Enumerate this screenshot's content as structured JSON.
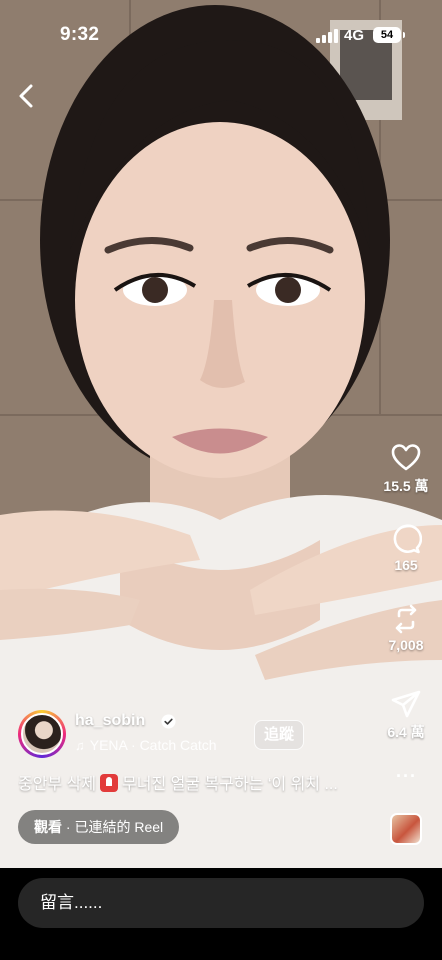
{
  "status_bar": {
    "time": "9:32",
    "network": "4G",
    "battery": "54"
  },
  "actions": {
    "likes": "15.5 萬",
    "comments": "165",
    "reposts": "7,008",
    "shares": "6.4 萬"
  },
  "author": {
    "username": "ha_sobin",
    "music_artist": "YENA",
    "music_title": "Catch Catch",
    "music_separator": "·",
    "follow_label": "追蹤"
  },
  "caption": {
    "part1": "중안부 삭제",
    "part2": "무너진 얼굴 복구하는 ‘이 위치 ..."
  },
  "more_label": "···",
  "reel_link": {
    "watch": "觀看",
    "separator": "·",
    "text": "已連結的 Reel"
  },
  "comment_placeholder": "留言......",
  "colors": {
    "accent_ring": "#ee2a7b",
    "siren": "#e23b3b",
    "comment_bg": "#262626"
  },
  "icons": [
    "back-icon",
    "heart-icon",
    "comment-icon",
    "repost-icon",
    "share-icon",
    "verified-icon",
    "music-note-icon",
    "siren-icon"
  ]
}
